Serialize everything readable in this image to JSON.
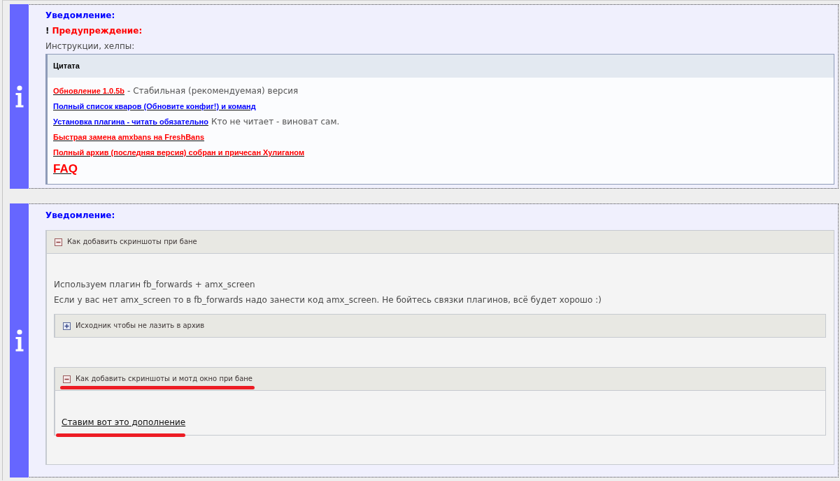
{
  "notices": [
    {
      "items": [
        {
          "kind": "notice",
          "text": "Уведомление:"
        },
        {
          "kind": "warning",
          "mark": "!",
          "text": "Предупреждение:"
        },
        {
          "kind": "text",
          "text": "Инструкции, хелпы:"
        },
        {
          "kind": "quote",
          "title": "Цитата",
          "lines": [
            {
              "kind": "line",
              "link": "Обновление 1.0.5b",
              "color": "#ff0000",
              "note": "- Стабильная (рекомендуемая) версия"
            },
            {
              "kind": "line",
              "link": "Полный список кваров (Обновите конфиг!) и команд",
              "color": "#0000ff"
            },
            {
              "kind": "line",
              "link": "Установка плагина - читать обязательно",
              "color": "#0000ff",
              "note": "Кто не читает - виноват сам."
            },
            {
              "kind": "line",
              "link": "Быстрая замена amxbans на FreshBans",
              "color": "#ff0000"
            },
            {
              "kind": "line",
              "link": "Полный архив (последняя версия) собран и причесан Хулиганом",
              "color": "#ff0000"
            },
            {
              "kind": "heading",
              "link": "FAQ",
              "color": "#ff0000"
            }
          ]
        }
      ]
    },
    {
      "items": [
        {
          "kind": "notice",
          "text": "Уведомление:"
        },
        {
          "kind": "spoiler",
          "title": "Как добавить скриншоты при бане",
          "expanded": true,
          "marked": false,
          "body": [
            {
              "kind": "text",
              "text": "Используем плагин fb_forwards + amx_screen",
              "marked": false
            },
            {
              "kind": "text",
              "text": "Если у вас нет amx_screen то в fb_forwards надо занести код amx_screen. Не бойтесь связки плагинов, всё будет хорошо :)",
              "marked": false
            },
            {
              "kind": "spoiler",
              "title": "Исходник чтобы не лазить в архив",
              "expanded": false,
              "marked": false
            },
            {
              "kind": "spoiler",
              "title": "Как добавить скриншоты и мотд окно при бане",
              "expanded": true,
              "marked": true,
              "body": [
                {
                  "kind": "link",
                  "text": "Ставим вот это дополнение",
                  "marked": true
                }
              ]
            }
          ]
        }
      ]
    }
  ]
}
